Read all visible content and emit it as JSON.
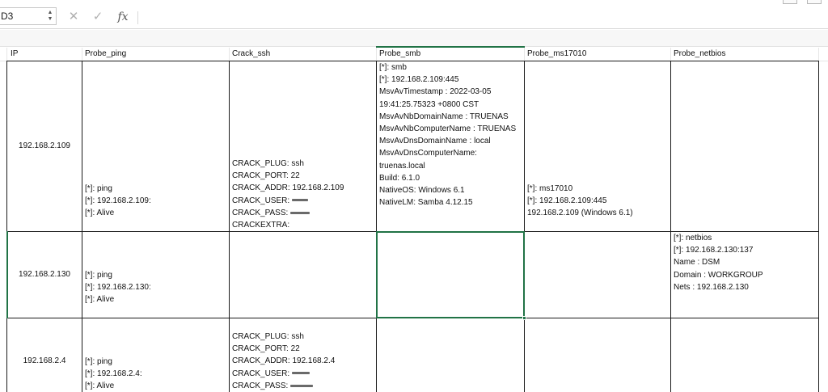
{
  "formula_bar": {
    "name_box": "D3",
    "cancel_symbol": "✕",
    "enter_symbol": "✓",
    "fx_label": "fx",
    "formula": ""
  },
  "columns": [
    "IP",
    "Probe_ping",
    "Crack_ssh",
    "Probe_smb",
    "Probe_ms17010",
    "Probe_netbios"
  ],
  "rows": [
    {
      "ip": "192.168.2.109",
      "ping": [
        "[*]: ping",
        "[*]: 192.168.2.109:",
        "[*]: Alive"
      ],
      "ssh": [
        "CRACK_PLUG: ssh",
        "CRACK_PORT: 22",
        "CRACK_ADDR: 192.168.2.109",
        "CRACK_USER:",
        "CRACK_PASS:",
        "CRACKEXTRA:"
      ],
      "smb": [
        "[*]: smb",
        "[*]: 192.168.2.109:445",
        "MsvAvTimestamp     : 2022-03-05",
        "19:41:25.75323 +0800 CST",
        "MsvAvNbDomainName  : TRUENAS",
        "MsvAvNbComputerName : TRUENAS",
        "MsvAvDnsDomainName  : local",
        "MsvAvDnsComputerName:",
        "truenas.local",
        "Build: 6.1.0",
        "NativeOS: Windows 6.1",
        "NativeLM: Samba 4.12.15"
      ],
      "ms17010": [
        "[*]: ms17010",
        "[*]: 192.168.2.109:445",
        "192.168.2.109  (Windows 6.1)"
      ],
      "netbios": []
    },
    {
      "ip": "192.168.2.130",
      "ping": [
        "[*]: ping",
        "[*]: 192.168.2.130:",
        "[*]: Alive"
      ],
      "ssh": [],
      "smb": [],
      "ms17010": [],
      "netbios": [
        "[*]: netbios",
        "[*]: 192.168.2.130:137",
        "Name    : DSM",
        "Domain  : WORKGROUP",
        "Nets    : 192.168.2.130"
      ]
    },
    {
      "ip": "192.168.2.4",
      "ping": [
        "[*]: ping",
        "[*]: 192.168.2.4:",
        "[*]: Alive"
      ],
      "ssh": [
        "CRACK_PLUG: ssh",
        "CRACK_PORT: 22",
        "CRACK_ADDR: 192.168.2.4",
        "CRACK_USER:",
        "CRACK_PASS:"
      ],
      "smb": [],
      "ms17010": [],
      "netbios": []
    }
  ],
  "colors": {
    "selection": "#217346",
    "border": "#1a1a1a",
    "gridline": "#e6e6e6"
  }
}
